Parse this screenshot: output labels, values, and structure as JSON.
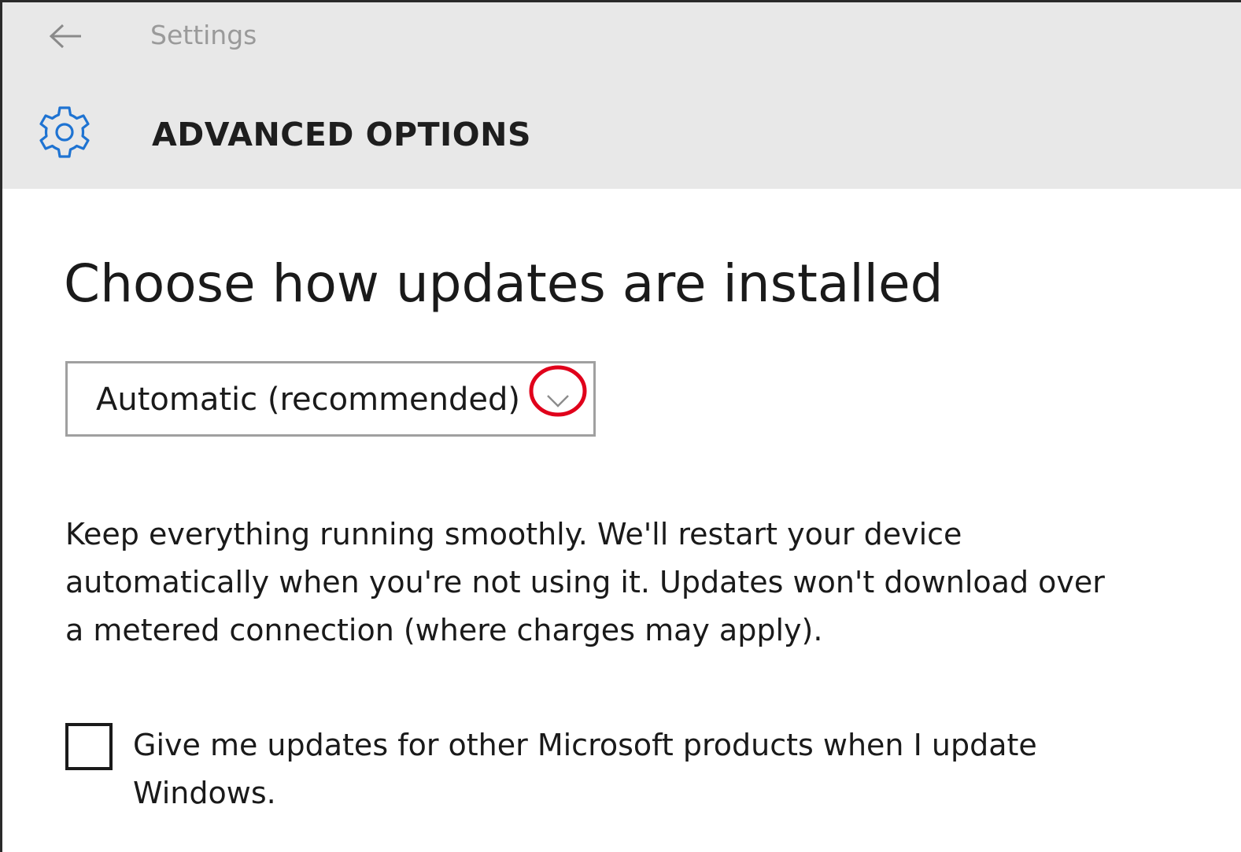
{
  "window": {
    "app_title": "Settings",
    "back_icon": "arrow-left-icon"
  },
  "header": {
    "icon": "gear-icon",
    "title": "ADVANCED OPTIONS",
    "accent_color": "#1e73d2"
  },
  "updates": {
    "section_title": "Choose how updates are installed",
    "install_mode": {
      "selected": "Automatic (recommended)",
      "chevron_icon": "chevron-down-icon",
      "highlight_color": "#e0001b"
    },
    "description": "Keep everything running smoothly. We'll restart your device automatically when you're not using it. Updates won't download over a metered connection (where charges may apply).",
    "other_products": {
      "checked": false,
      "label": "Give me updates for other Microsoft products when I update Windows."
    }
  }
}
